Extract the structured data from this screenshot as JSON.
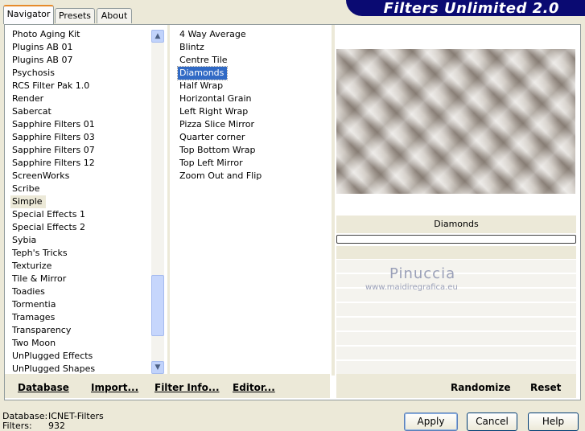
{
  "tabs": [
    {
      "label": "Navigator"
    },
    {
      "label": "Presets"
    },
    {
      "label": "About"
    }
  ],
  "banner_title": "Filters Unlimited 2.0",
  "categories": [
    "Photo Aging Kit",
    "Plugins AB 01",
    "Plugins AB 07",
    "Psychosis",
    "RCS Filter Pak 1.0",
    "Render",
    "Sabercat",
    "Sapphire Filters 01",
    "Sapphire Filters 03",
    "Sapphire Filters 07",
    "Sapphire Filters 12",
    "ScreenWorks",
    "Scribe",
    "Simple",
    "Special Effects 1",
    "Special Effects 2",
    "Sybia",
    "Teph's Tricks",
    "Texturize",
    "Tile & Mirror",
    "Toadies",
    "Tormentia",
    "Tramages",
    "Transparency",
    "Two Moon",
    "UnPlugged Effects",
    "UnPlugged Shapes"
  ],
  "selected_category": "Simple",
  "filters": [
    "4 Way Average",
    "Blintz",
    "Centre Tile",
    "Diamonds",
    "Half Wrap",
    "Horizontal Grain",
    "Left Right Wrap",
    "Pizza Slice Mirror",
    "Quarter corner",
    "Top Bottom Wrap",
    "Top Left Mirror",
    "Zoom Out and Flip"
  ],
  "selected_filter": "Diamonds",
  "preview_label": "Diamonds",
  "watermark": {
    "line1": "Pinuccia",
    "line2": "www.maidiregrafica.eu"
  },
  "footer_links": {
    "database": "Database",
    "import": "Import...",
    "filter_info": "Filter Info...",
    "editor": "Editor...",
    "randomize": "Randomize",
    "reset": "Reset"
  },
  "status": {
    "database_label": "Database:",
    "database_value": "ICNET-Filters",
    "filters_label": "Filters:",
    "filters_value": "932"
  },
  "buttons": {
    "apply": "Apply",
    "cancel": "Cancel",
    "help": "Help"
  },
  "scrollbar": {
    "up_icon": "up-arrow-icon",
    "down_icon": "down-arrow-icon"
  }
}
